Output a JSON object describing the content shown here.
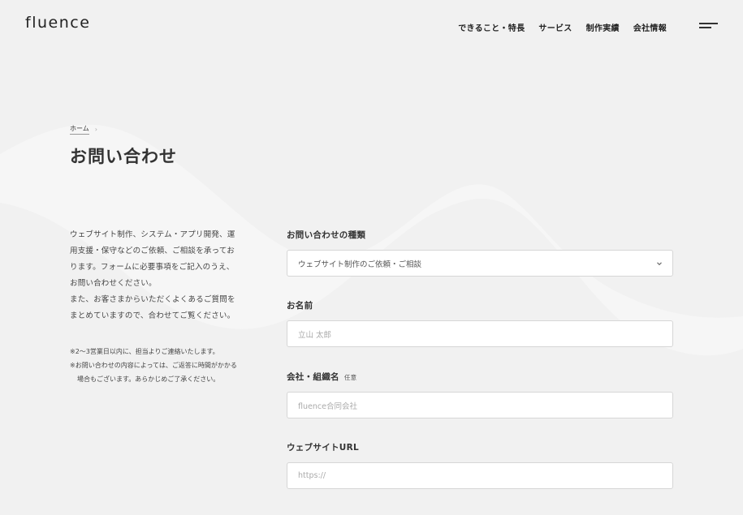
{
  "header": {
    "logo": "fluence",
    "nav": [
      "できること・特長",
      "サービス",
      "制作実績",
      "会社情報"
    ]
  },
  "breadcrumb": {
    "home": "ホーム",
    "separator": "›"
  },
  "page_title": "お問い合わせ",
  "intro": {
    "lines": [
      "ウェブサイト制作、システム・アプリ開発、運",
      "用支援・保守などのご依頼、ご相談を承ってお",
      "ります。フォームに必要事項をご記入のうえ、",
      "お問い合わせください。",
      "また、お客さまからいただくよくあるご質問を",
      "まとめていますので、合わせてご覧ください。"
    ],
    "notes": [
      "※2〜3営業日以内に、担当よりご連絡いたします。",
      "※お問い合わせの内容によっては、ご返答に時間がかかる場合もございます。あらかじめご了承ください。"
    ]
  },
  "form": {
    "inquiry_type": {
      "label": "お問い合わせの種類",
      "value": "ウェブサイト制作のご依頼・ご相談"
    },
    "name": {
      "label": "お名前",
      "placeholder": "立山 太郎"
    },
    "company": {
      "label": "会社・組織名",
      "optional": "任意",
      "placeholder": "fluence合同会社"
    },
    "website": {
      "label": "ウェブサイトURL",
      "placeholder": "https://"
    }
  },
  "icons": {
    "menu": "hamburger-menu-icon",
    "select": "chevron-down-icon",
    "separator": "chevron-right-icon"
  }
}
